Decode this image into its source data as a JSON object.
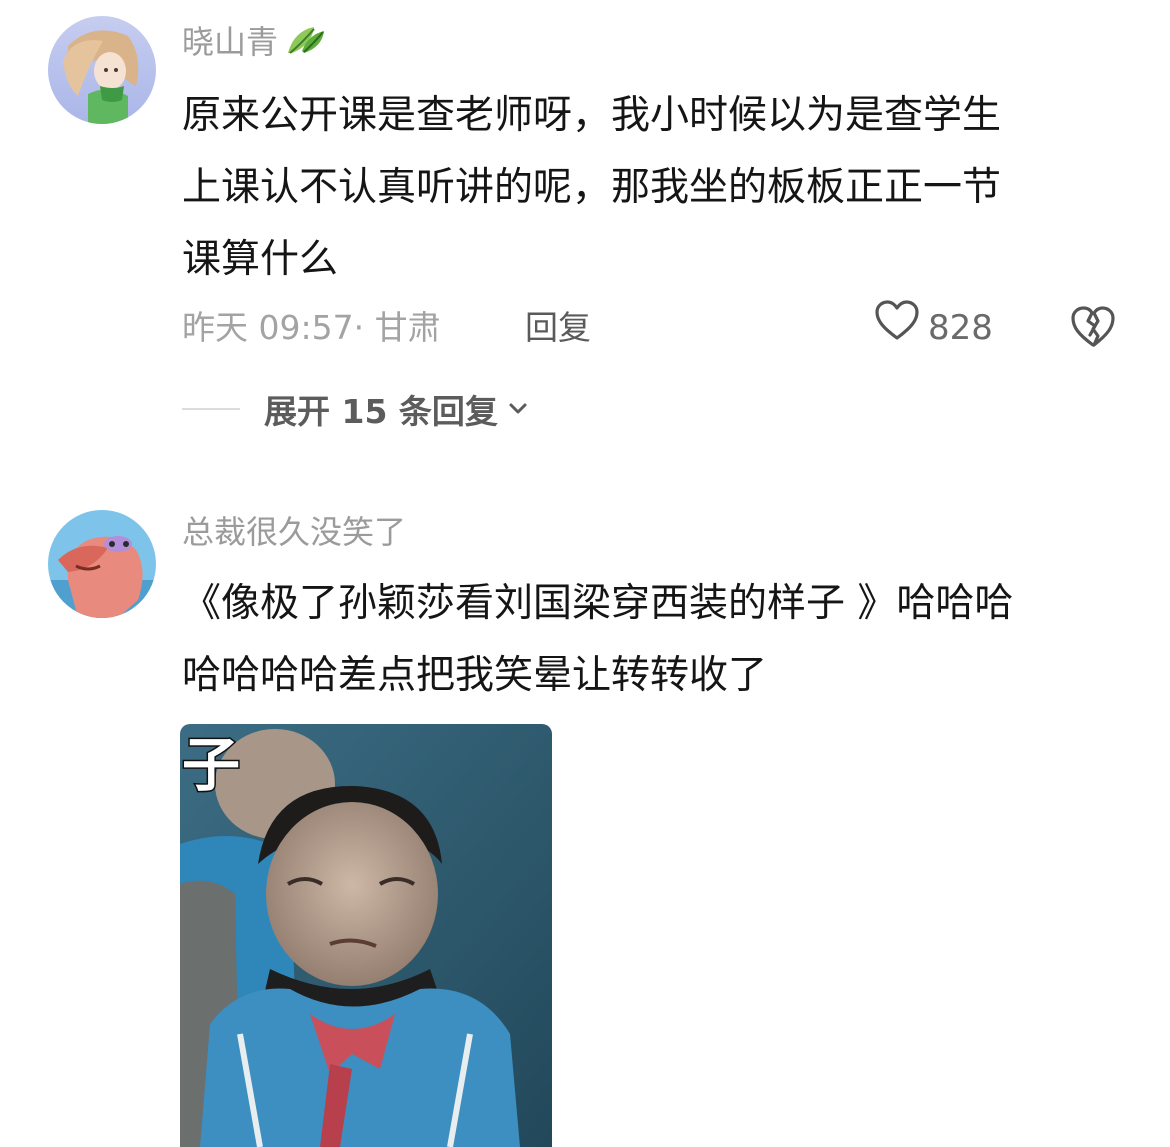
{
  "comments": [
    {
      "username": "晓山青",
      "badge_icon": "leaf-badge-icon",
      "text_lines": [
        "原来公开课是查老师呀，我小时候以为是查学生",
        "上课认不认真听讲的呢，那我坐的板板正正一节",
        "课算什么"
      ],
      "time_location": "昨天 09:57· 甘肃",
      "reply_label": "回复",
      "like_count": "828",
      "expand_label": "展开 15 条回复"
    },
    {
      "username": "总裁很久没笑了",
      "text_lines": [
        "《像极了孙颖莎看刘国梁穿西装的样子 》哈哈哈",
        "哈哈哈哈差点把我笑晕让转转收了"
      ],
      "meme_caption": "子"
    }
  ],
  "colors": {
    "username": "#9b9b9b",
    "body_text": "#151515",
    "meta_text": "#a3a3a3",
    "reply": "#5a5a5a",
    "expand": "#5c5c5c"
  }
}
